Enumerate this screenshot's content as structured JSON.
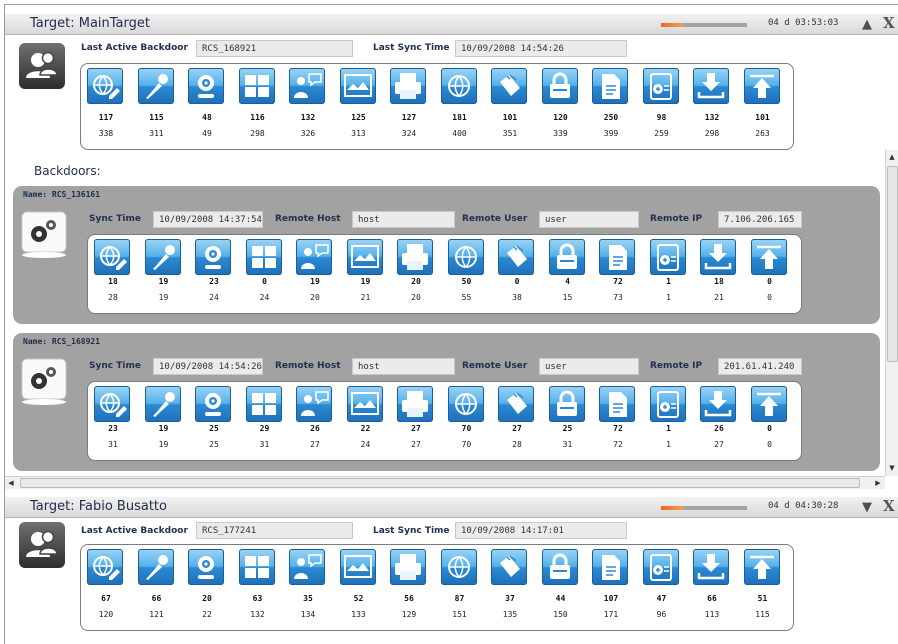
{
  "targets": [
    {
      "title": "Target: MainTarget",
      "progress": 0.25,
      "uptime": "04 d 03:53:03",
      "toggle_icon": "▲",
      "close_icon": "X",
      "last_backdoor_label": "Last Active Backdoor",
      "last_backdoor": "RCS_168921",
      "last_sync_label": "Last Sync Time",
      "last_sync": "10/09/2008 14:54:26",
      "counts_top": [
        "117",
        "115",
        "48",
        "116",
        "132",
        "125",
        "127",
        "181",
        "101",
        "120",
        "250",
        "98",
        "132",
        "101"
      ],
      "counts_bottom": [
        "338",
        "311",
        "49",
        "298",
        "326",
        "313",
        "324",
        "400",
        "351",
        "339",
        "399",
        "259",
        "298",
        "263"
      ]
    },
    {
      "title": "Target: Fabio Busatto",
      "progress": 0.25,
      "uptime": "04 d 04:30:28",
      "toggle_icon": "▼",
      "close_icon": "X",
      "last_backdoor_label": "Last Active Backdoor",
      "last_backdoor": "RCS_177241",
      "last_sync_label": "Last Sync Time",
      "last_sync": "10/09/2008 14:17:01",
      "counts_top": [
        "67",
        "66",
        "20",
        "63",
        "35",
        "52",
        "56",
        "87",
        "37",
        "44",
        "107",
        "47",
        "66",
        "51"
      ],
      "counts_bottom": [
        "120",
        "121",
        "22",
        "132",
        "134",
        "133",
        "129",
        "151",
        "135",
        "150",
        "171",
        "96",
        "113",
        "115"
      ]
    }
  ],
  "backdoors_title": "Backdoors:",
  "backdoors": [
    {
      "name": "Name: RCS_136161",
      "sync_label": "Sync Time",
      "sync_time": "10/09/2008 14:37:54",
      "host_label": "Remote Host",
      "host": "host",
      "user_label": "Remote User",
      "user": "user",
      "ip_label": "Remote IP",
      "ip": "7.106.206.165",
      "counts_top": [
        "18",
        "19",
        "23",
        "0",
        "19",
        "19",
        "20",
        "50",
        "0",
        "4",
        "72",
        "1",
        "18",
        "0"
      ],
      "counts_bottom": [
        "28",
        "19",
        "24",
        "24",
        "20",
        "21",
        "20",
        "55",
        "38",
        "15",
        "73",
        "1",
        "21",
        "0"
      ]
    },
    {
      "name": "Name: RCS_168921",
      "sync_label": "Sync Time",
      "sync_time": "10/09/2008 14:54:26",
      "host_label": "Remote Host",
      "host": "host",
      "user_label": "Remote User",
      "user": "user",
      "ip_label": "Remote IP",
      "ip": "201.61.41.240",
      "counts_top": [
        "23",
        "19",
        "25",
        "29",
        "26",
        "22",
        "27",
        "70",
        "27",
        "25",
        "72",
        "1",
        "26",
        "0"
      ],
      "counts_bottom": [
        "31",
        "19",
        "25",
        "31",
        "27",
        "24",
        "27",
        "70",
        "28",
        "31",
        "72",
        "1",
        "27",
        "0"
      ]
    }
  ],
  "module_icons": [
    "web-icon",
    "microphone-icon",
    "webcam-icon",
    "application-icon",
    "messenger-icon",
    "screenshot-icon",
    "print-icon",
    "url-icon",
    "keylog-icon",
    "password-icon",
    "document-icon",
    "clipboard-icon",
    "download-icon",
    "upload-icon"
  ],
  "colors": {
    "tile": "#2b8ad3",
    "panel": "#a2a2a2",
    "title_text": "#1e2d4a",
    "progress": "#f26522"
  },
  "scrollbars": {
    "up": "▲",
    "down": "▼",
    "left": "◀",
    "right": "▶"
  }
}
